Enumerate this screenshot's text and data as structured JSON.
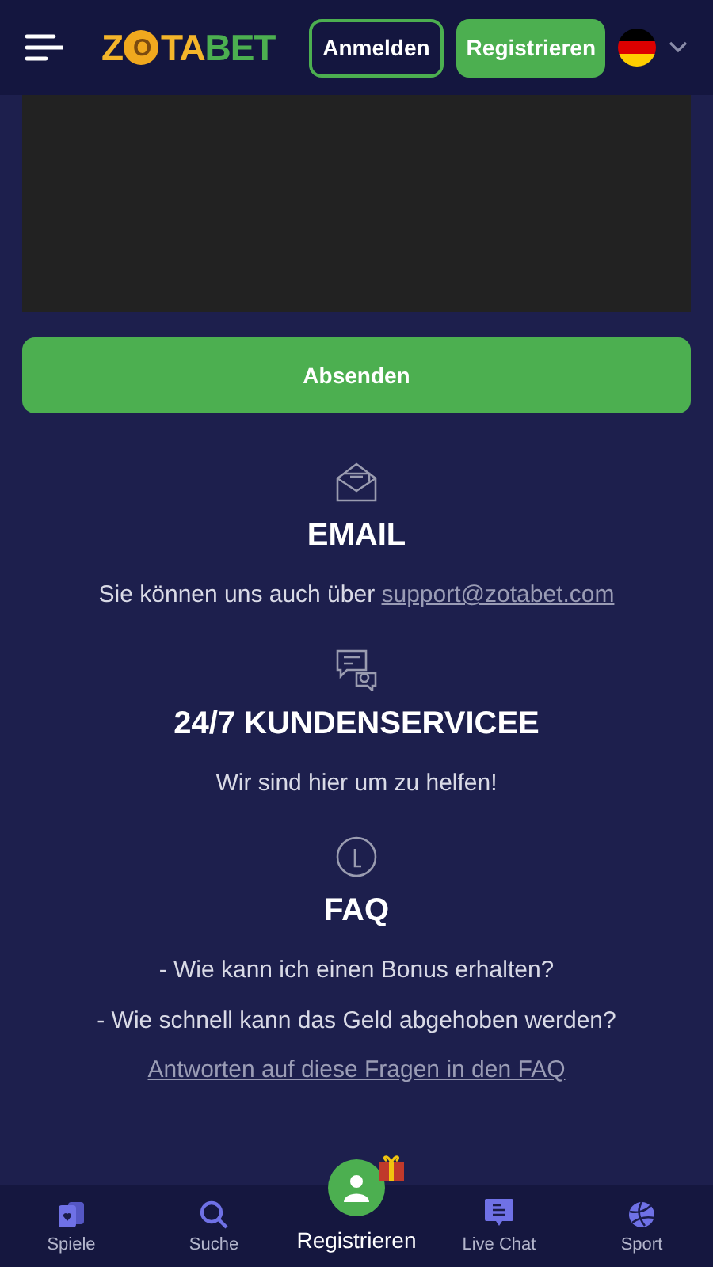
{
  "header": {
    "logo": {
      "first": "Z",
      "coin": "O",
      "middle": "TA",
      "last": "BET"
    },
    "login": "Anmelden",
    "register": "Registrieren"
  },
  "form": {
    "submit": "Absenden"
  },
  "sections": [
    {
      "kind": "email",
      "title": "EMAIL",
      "lines": [
        {
          "text": "Sie können uns auch über ",
          "link": "support@zotabet.com"
        }
      ]
    },
    {
      "kind": "chat",
      "title": "24/7 KUNDENSERVICEE",
      "lines": [
        {
          "text": "Wir sind hier um zu helfen!"
        }
      ]
    },
    {
      "kind": "faq",
      "title": "FAQ",
      "lines": [
        {
          "text": "- Wie kann ich einen Bonus erhalten?"
        },
        {
          "text": "- Wie schnell kann das Geld abgehoben werden?"
        },
        {
          "link": "Antworten auf diese Fragen in den FAQ"
        }
      ]
    }
  ],
  "nav": [
    {
      "kind": "cards",
      "label": "Spiele"
    },
    {
      "kind": "search",
      "label": "Suche"
    },
    {
      "kind": "register",
      "label": "Registrieren"
    },
    {
      "kind": "chat",
      "label": "Live Chat"
    },
    {
      "kind": "ball",
      "label": "Sport"
    }
  ]
}
